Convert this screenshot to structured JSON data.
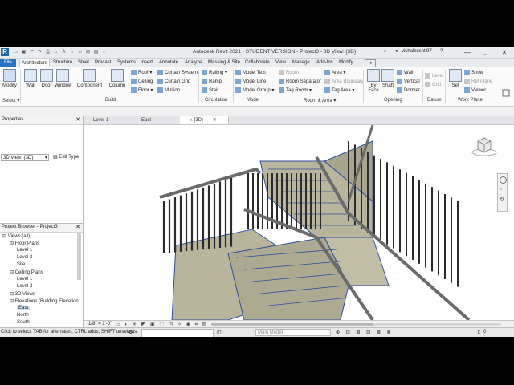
{
  "window": {
    "title": "Autodesk Revit 2021 - STUDENT VERSION - Project3 - 3D View: {3D}",
    "user": "vishalkoshti97",
    "logo": "R",
    "min": "—",
    "max": "□",
    "close": "✕"
  },
  "tabs": [
    "File",
    "Architecture",
    "Structure",
    "Steel",
    "Precast",
    "Systems",
    "Insert",
    "Annotate",
    "Analyze",
    "Massing & Site",
    "Collaborate",
    "View",
    "Manage",
    "Add-Ins",
    "Modify"
  ],
  "ribbon": {
    "select": {
      "modify": "Modify",
      "label": "Select ▾"
    },
    "build": {
      "wall": "Wall",
      "door": "Door",
      "window": "Window",
      "component": "Component",
      "column": "Column",
      "roof": "Roof ▾",
      "ceiling": "Ceiling",
      "floor": "Floor ▾",
      "curtain_system": "Curtain System",
      "curtain_grid": "Curtain Grid",
      "mullion": "Mullion",
      "label": "Build"
    },
    "circulation": {
      "railing": "Railing ▾",
      "ramp": "Ramp",
      "stair": "Stair",
      "label": "Circulation"
    },
    "model": {
      "text": "Model Text",
      "line": "Model Line",
      "group": "Model Group ▾",
      "label": "Model"
    },
    "room_area": {
      "room": "Room",
      "room_separator": "Room Separator",
      "tag_room": "Tag Room ▾",
      "area": "Area ▾",
      "area_boundary": "Area Boundary",
      "tag_area": "Tag Area ▾",
      "label": "Room & Area ▾"
    },
    "opening": {
      "by_face": "By Face",
      "shaft": "Shaft",
      "wall": "Wall",
      "vertical": "Vertical",
      "dormer": "Dormer",
      "label": "Opening"
    },
    "datum": {
      "level": "Level",
      "grid": "Grid",
      "label": "Datum"
    },
    "work_plane": {
      "set": "Set",
      "show": "Show",
      "ref_plane": "Ref Plane",
      "viewer": "Viewer",
      "label": "Work Plane"
    }
  },
  "properties": {
    "title": "Properties",
    "view_type": "3D View: {3D}",
    "edit_type": "Edit Type",
    "close": "✕"
  },
  "browser": {
    "title": "Project Browser - Project3",
    "close": "✕",
    "items": [
      {
        "label": "Views (all)",
        "indent": 0
      },
      {
        "label": "Floor Plans",
        "indent": 1
      },
      {
        "label": "Level 1",
        "indent": 2
      },
      {
        "label": "Level 2",
        "indent": 2
      },
      {
        "label": "Site",
        "indent": 2
      },
      {
        "label": "Ceiling Plans",
        "indent": 1
      },
      {
        "label": "Level 1",
        "indent": 2
      },
      {
        "label": "Level 2",
        "indent": 2
      },
      {
        "label": "3D Views",
        "indent": 1
      },
      {
        "label": "Elevations (Building Elevation",
        "indent": 1
      },
      {
        "label": "East",
        "indent": 2
      },
      {
        "label": "North",
        "indent": 2
      },
      {
        "label": "South",
        "indent": 2
      }
    ]
  },
  "view_tabs": [
    {
      "label": "Level 1"
    },
    {
      "label": "East"
    },
    {
      "label": "{3D}"
    }
  ],
  "view_control": {
    "scale": "1/8\" = 1'-0\""
  },
  "status": {
    "message": "Click to select, TAB for alternates, CTRL adds, SHIFT unselects.",
    "model": "Main Model",
    "filter": "0"
  }
}
